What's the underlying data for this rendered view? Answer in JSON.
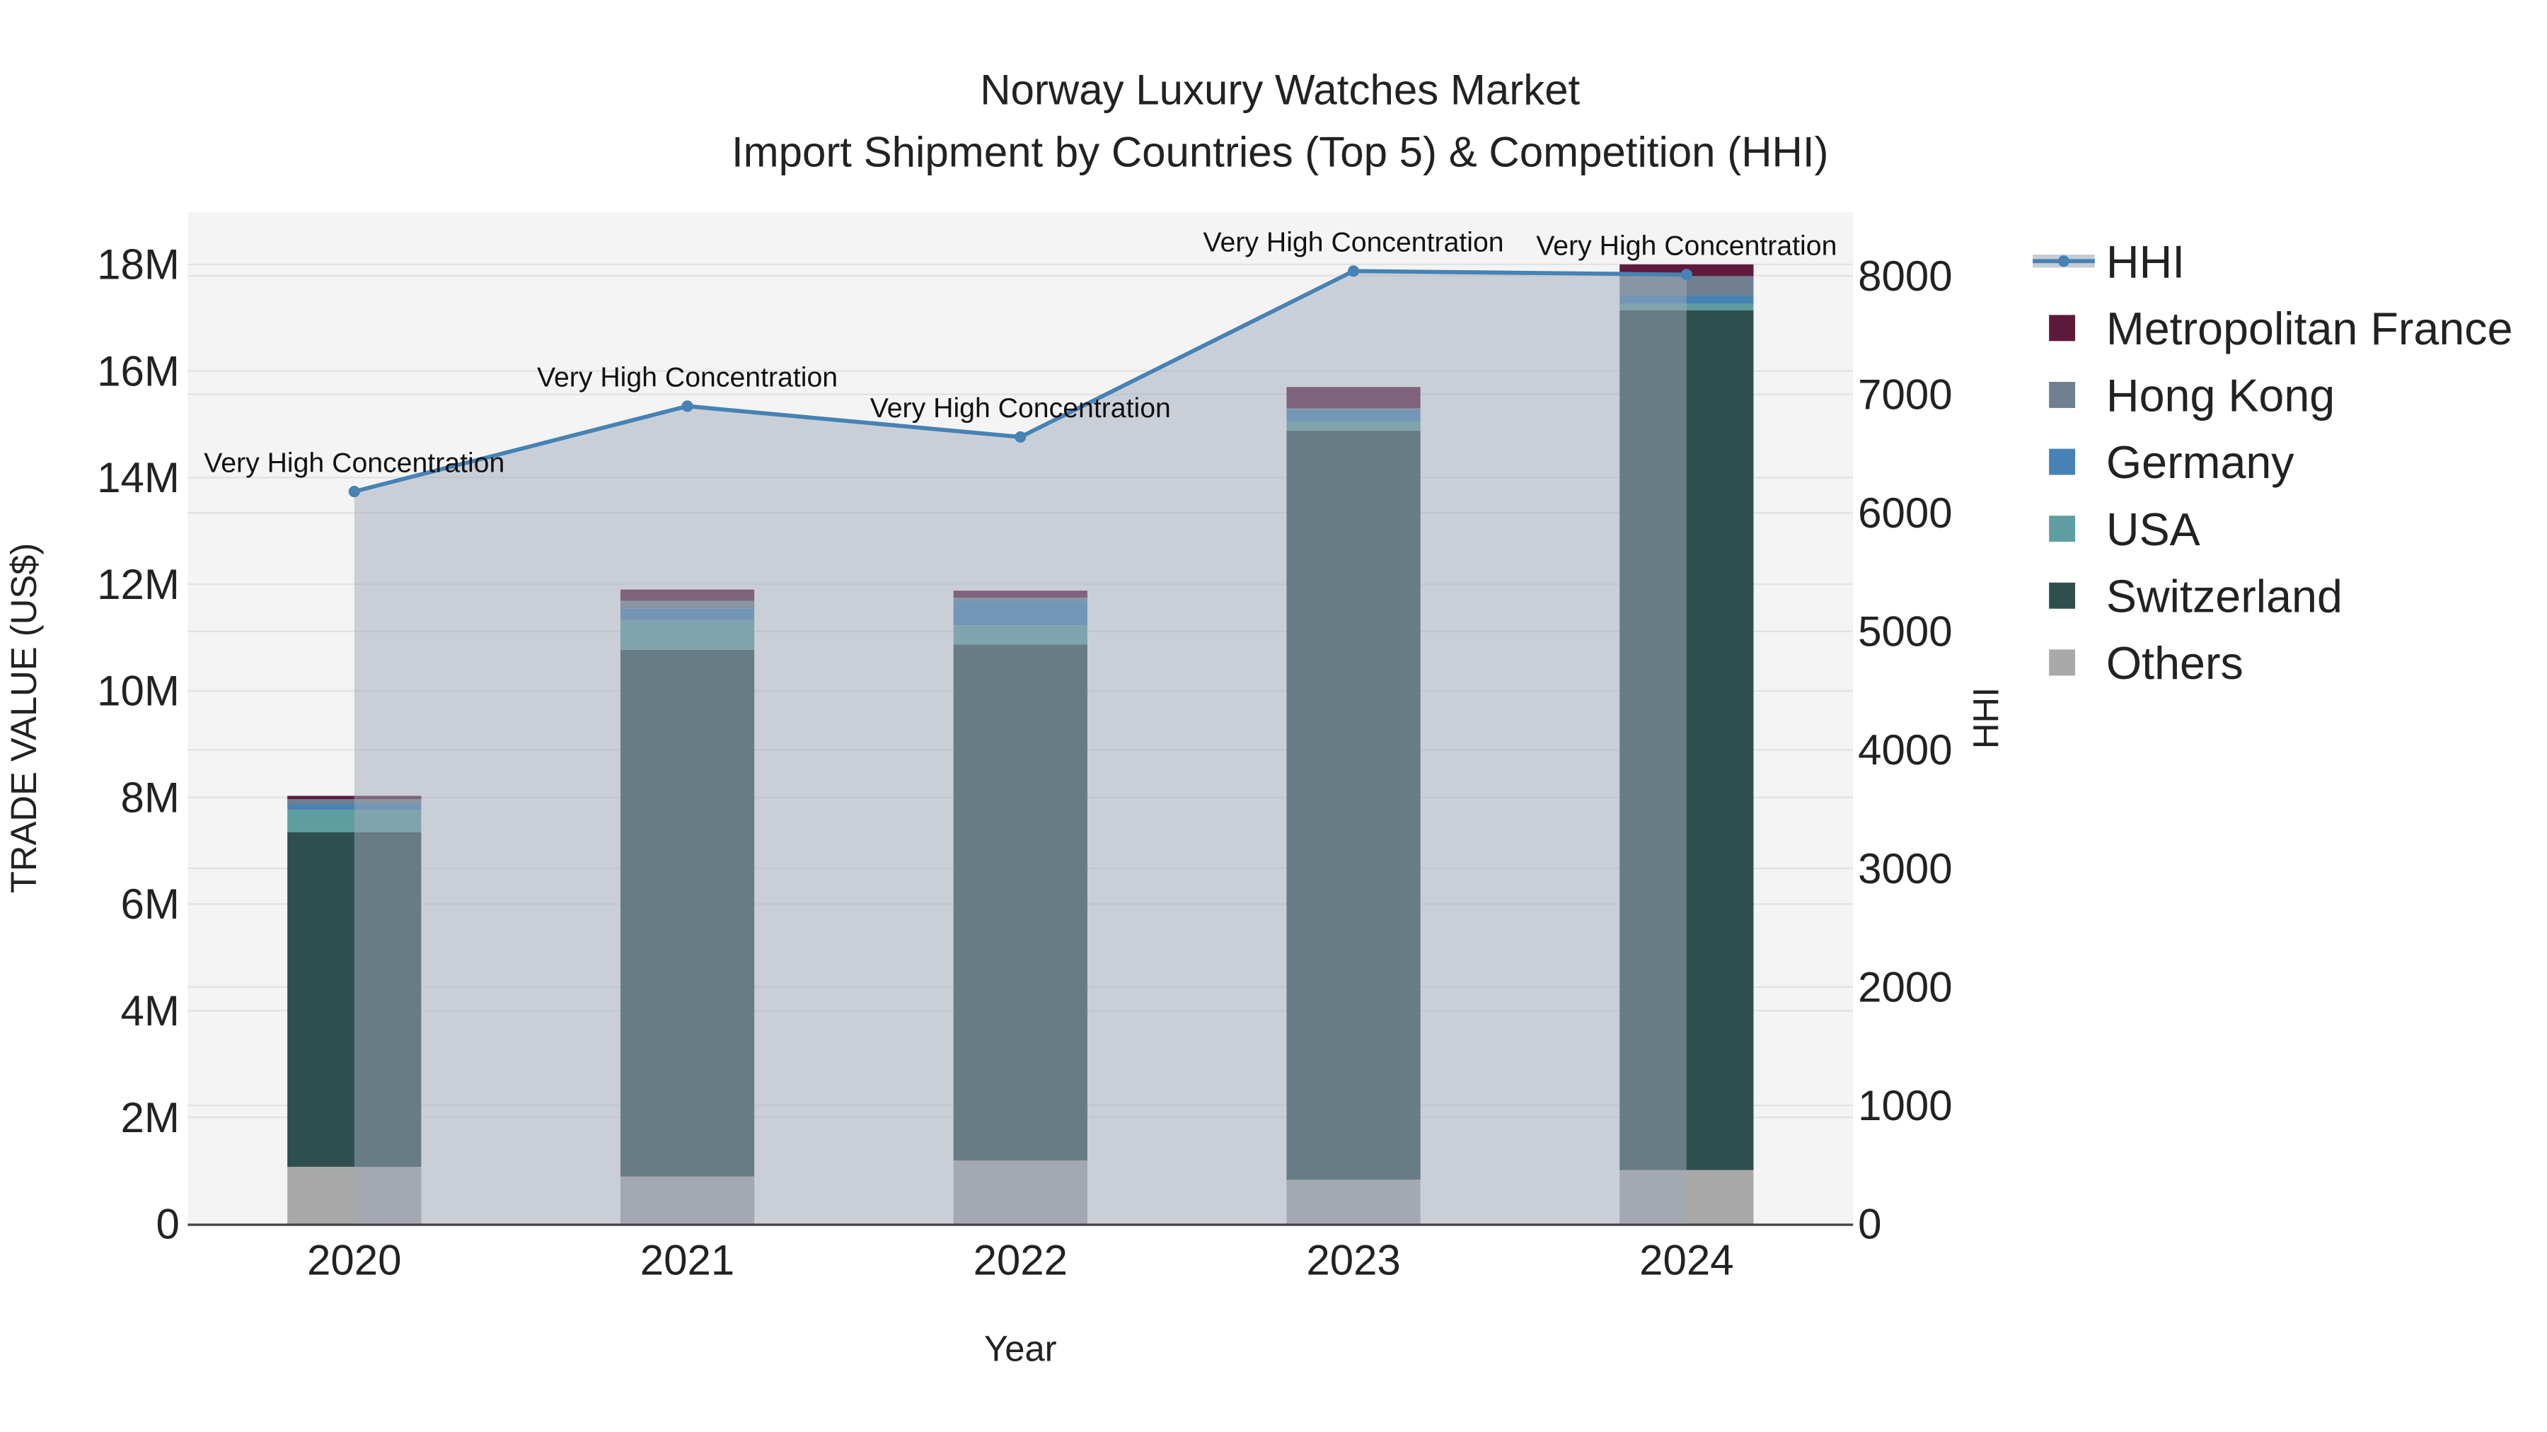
{
  "chart_data": {
    "type": "bar",
    "title": "Norway Luxury Watches Market",
    "subtitle": "Import Shipment by Countries (Top 5) & Competition (HHI)",
    "xlabel": "Year",
    "ylabel": "TRADE VALUE (US$)",
    "y2label": "HHI",
    "categories": [
      "2020",
      "2021",
      "2022",
      "2023",
      "2024"
    ],
    "ylim": [
      0,
      19000000
    ],
    "y2lim": [
      0,
      8500
    ],
    "yticks": [
      0,
      2000000,
      4000000,
      6000000,
      8000000,
      10000000,
      12000000,
      14000000,
      16000000,
      18000000
    ],
    "ytick_labels": [
      "0",
      "2M",
      "4M",
      "6M",
      "8M",
      "10M",
      "12M",
      "14M",
      "16M",
      "18M"
    ],
    "y2ticks": [
      0,
      1000,
      2000,
      3000,
      4000,
      5000,
      6000,
      7000,
      8000
    ],
    "y2tick_labels": [
      "0",
      "1000",
      "2000",
      "3000",
      "4000",
      "5000",
      "6000",
      "7000",
      "8000"
    ],
    "series": [
      {
        "name": "Others",
        "color": "#A9A9A9",
        "values": [
          1070000,
          890000,
          1190000,
          830000,
          1010000
        ]
      },
      {
        "name": "Switzerland",
        "color": "#2F4F4F",
        "values": [
          6280000,
          9880000,
          9680000,
          14050000,
          16130000
        ]
      },
      {
        "name": "USA",
        "color": "#5F9EA0",
        "values": [
          420000,
          560000,
          360000,
          180000,
          120000
        ]
      },
      {
        "name": "Germany",
        "color": "#4682B4",
        "values": [
          100000,
          210000,
          460000,
          210000,
          160000
        ]
      },
      {
        "name": "Hong Kong",
        "color": "#708090",
        "values": [
          100000,
          150000,
          60000,
          30000,
          360000
        ]
      },
      {
        "name": "Metropolitan France",
        "color": "#5E1A3C",
        "values": [
          60000,
          210000,
          130000,
          400000,
          220000
        ]
      }
    ],
    "hhi": {
      "name": "HHI",
      "color": "#4682B4",
      "values": [
        6180,
        6900,
        6640,
        8040,
        8010
      ],
      "annotations": [
        "Very High Concentration",
        "Very High Concentration",
        "Very High Concentration",
        "Very High Concentration",
        "Very High Concentration"
      ]
    },
    "legend_order": [
      "HHI",
      "Metropolitan France",
      "Hong Kong",
      "Germany",
      "USA",
      "Switzerland",
      "Others"
    ],
    "legend_placement": "right",
    "grid": true
  }
}
